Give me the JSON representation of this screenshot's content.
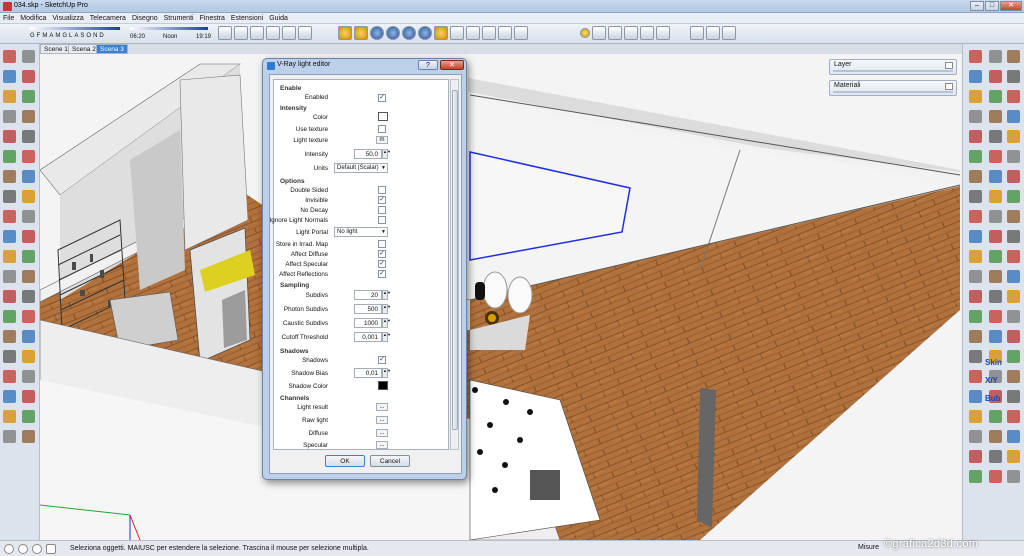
{
  "window": {
    "title": "034.skp - SketchUp Pro",
    "min": "–",
    "max": "□",
    "close": "✕"
  },
  "menu": [
    "File",
    "Modifica",
    "Visualizza",
    "Telecamera",
    "Disegno",
    "Strumenti",
    "Finestra",
    "Estensioni",
    "Guida"
  ],
  "shadow": {
    "months": [
      "G",
      "F",
      "M",
      "A",
      "M",
      "G",
      "L",
      "A",
      "S",
      "O",
      "N",
      "D"
    ],
    "time_start": "06:20",
    "time_mid": "Noon",
    "time_end": "19:19"
  },
  "scenes": [
    "Scene 1",
    "Scena 2",
    "Scena 3"
  ],
  "trays": {
    "layer": "Layer",
    "materiali": "Materiali"
  },
  "right_labels": {
    "skin": "Skin",
    "xy": "X/Y",
    "bub": "Bub"
  },
  "status": {
    "text": "Seleziona oggetti. MAIUSC per estendere la selezione. Trascina il mouse per selezione multipla.",
    "vcb": "Misure"
  },
  "watermark": "©grafica2d3d.com",
  "dialog": {
    "title": "V-Ray light editor",
    "help": "?",
    "close": "✕",
    "sections": {
      "enable": "Enable",
      "intensity": "Intensity",
      "options": "Options",
      "sampling": "Sampling",
      "shadows": "Shadows",
      "channels": "Channels"
    },
    "enabled_label": "Enabled",
    "color_label": "Color",
    "use_texture_label": "Use texture",
    "light_texture_label": "Light texture",
    "light_texture_btn": "m",
    "intensity_label": "Intensity",
    "intensity_value": "50,0",
    "units_label": "Units",
    "units_value": "Default (Scalar)",
    "options": {
      "double_sided": "Double Sided",
      "invisible": "Invisible",
      "no_decay": "No Decay",
      "ignore_normals": "Ignore Light Normals",
      "light_portal": "Light Portal",
      "light_portal_value": "No light",
      "store_irrad": "Store in Irrad. Map",
      "affect_diffuse": "Affect Diffuse",
      "affect_specular": "Affect Specular",
      "affect_reflections": "Affect Reflections"
    },
    "sampling": {
      "subdivs": "Subdivs",
      "subdivs_value": "20",
      "photon": "Photon Subdivs",
      "photon_value": "500",
      "caustic": "Caustic Subdivs",
      "caustic_value": "1000",
      "cutoff": "Cutoff Threshold",
      "cutoff_value": "0,001"
    },
    "shadows": {
      "shadows": "Shadows",
      "bias": "Shadow Bias",
      "bias_value": "0,01",
      "color": "Shadow Color"
    },
    "channels": {
      "light_result": "Light result",
      "raw_light": "Raw light",
      "diffuse": "Diffuse",
      "specular": "Specular",
      "btn": "..."
    },
    "ok": "OK",
    "cancel": "Cancel",
    "check": "✓"
  },
  "colors": {
    "accent": "#3a7fd9",
    "floor": "#b0713c",
    "white_swatch": "#ffffff",
    "shadow_swatch": "#000000"
  }
}
